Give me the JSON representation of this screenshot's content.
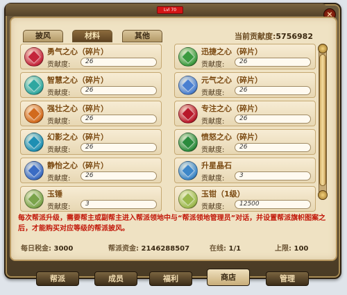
{
  "window": {
    "title_badge": "Lvl 70",
    "close_icon": "×"
  },
  "tabs": [
    {
      "label": "披风",
      "active": false
    },
    {
      "label": "材料",
      "active": true
    },
    {
      "label": "其他",
      "active": false
    }
  ],
  "contribution": {
    "label": "当前贡献度:",
    "value": "5756982"
  },
  "items": [
    {
      "name": "勇气之心（碎片）",
      "contrib_label": "贡献度:",
      "value": "26",
      "icon": "red-crystal-icon",
      "color": "#c4253b"
    },
    {
      "name": "迅捷之心（碎片）",
      "contrib_label": "贡献度:",
      "value": "26",
      "icon": "green-crystal-icon",
      "color": "#3a9a3f"
    },
    {
      "name": "智慧之心（碎片）",
      "contrib_label": "贡献度:",
      "value": "26",
      "icon": "teal-crystal-icon",
      "color": "#2fa7a0"
    },
    {
      "name": "元气之心（碎片）",
      "contrib_label": "贡献度:",
      "value": "26",
      "icon": "blue-crystal-icon",
      "color": "#4a7fd0"
    },
    {
      "name": "强壮之心（碎片）",
      "contrib_label": "贡献度:",
      "value": "26",
      "icon": "orange-crystal-icon",
      "color": "#d26a1d"
    },
    {
      "name": "专注之心（碎片）",
      "contrib_label": "贡献度:",
      "value": "26",
      "icon": "crimson-star-icon",
      "color": "#b8182a"
    },
    {
      "name": "幻影之心（碎片）",
      "contrib_label": "贡献度:",
      "value": "26",
      "icon": "cyan-crystal-icon",
      "color": "#1d8fb3"
    },
    {
      "name": "愤怒之心（碎片）",
      "contrib_label": "贡献度:",
      "value": "26",
      "icon": "emerald-crystal-icon",
      "color": "#2b8b3d"
    },
    {
      "name": "静怡之心（碎片）",
      "contrib_label": "贡献度:",
      "value": "26",
      "icon": "azure-crystal-icon",
      "color": "#3a6cc4"
    },
    {
      "name": "升星晶石",
      "contrib_label": "贡献度:",
      "value": "3",
      "icon": "star-crystal-icon",
      "color": "#3d87c9"
    },
    {
      "name": "玉锤",
      "contrib_label": "贡献度:",
      "value": "3",
      "icon": "jade-hammer-icon",
      "color": "#7aa34a"
    },
    {
      "name": "玉钳（1级）",
      "contrib_label": "贡献度:",
      "value": "12500",
      "icon": "jade-tongs-icon",
      "color": "#9ab84c"
    }
  ],
  "notice": "每次帮派升级，需要帮主或副帮主进入帮派领地中与“帮派领地管理员”对话，并设置帮派旗帜图案之后，才能购买对应等级的帮派披风。",
  "stats": {
    "tax_label": "每日税金:",
    "tax_value": "3000",
    "funds_label": "帮派资金:",
    "funds_value": "2146288507",
    "online_label": "在线:",
    "online_value": "1/1",
    "limit_label": "上限:",
    "limit_value": "100"
  },
  "nav": [
    {
      "label": "帮派",
      "active": false
    },
    {
      "label": "成员",
      "active": false
    },
    {
      "label": "福利",
      "active": false
    },
    {
      "label": "商店",
      "active": true
    },
    {
      "label": "管理",
      "active": false
    }
  ]
}
